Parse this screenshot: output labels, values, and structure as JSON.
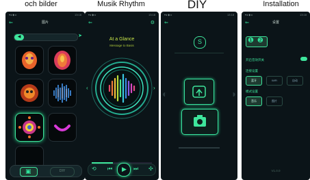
{
  "captions": {
    "p1": "och bilder",
    "p2": "Musik Rhythm",
    "p3": "DIY",
    "p4": "Installation"
  },
  "p1": {
    "status_left": "▾◂ ◆ ▸",
    "status_right": "13:18",
    "title": "图片",
    "tab_right": "➤",
    "bottom_tab_label": "DIY"
  },
  "p2": {
    "status_left": "▾◂ ◆ ▸",
    "status_right": "13:18",
    "song_title": "At a Glance",
    "song_sub": "Message to Basis"
  },
  "p3": {
    "status_left": "▾◂ ◆ ▸",
    "status_right": "13:18"
  },
  "p4": {
    "status_left": "▾◂ ◆ ▸",
    "status_right": "13:18",
    "title": "设置",
    "row1_label": "开启音效开关",
    "row2_label": "连接设置",
    "row2_opts": [
      "蓝牙",
      "WiFi",
      "自动"
    ],
    "row3_label": "模式设置",
    "row3_opts": [
      "音乐",
      "图片"
    ],
    "footer": "V1.0.0"
  },
  "colors": {
    "accent": "#3ee59c",
    "bg": "#0b1418",
    "panel": "#101c20"
  }
}
